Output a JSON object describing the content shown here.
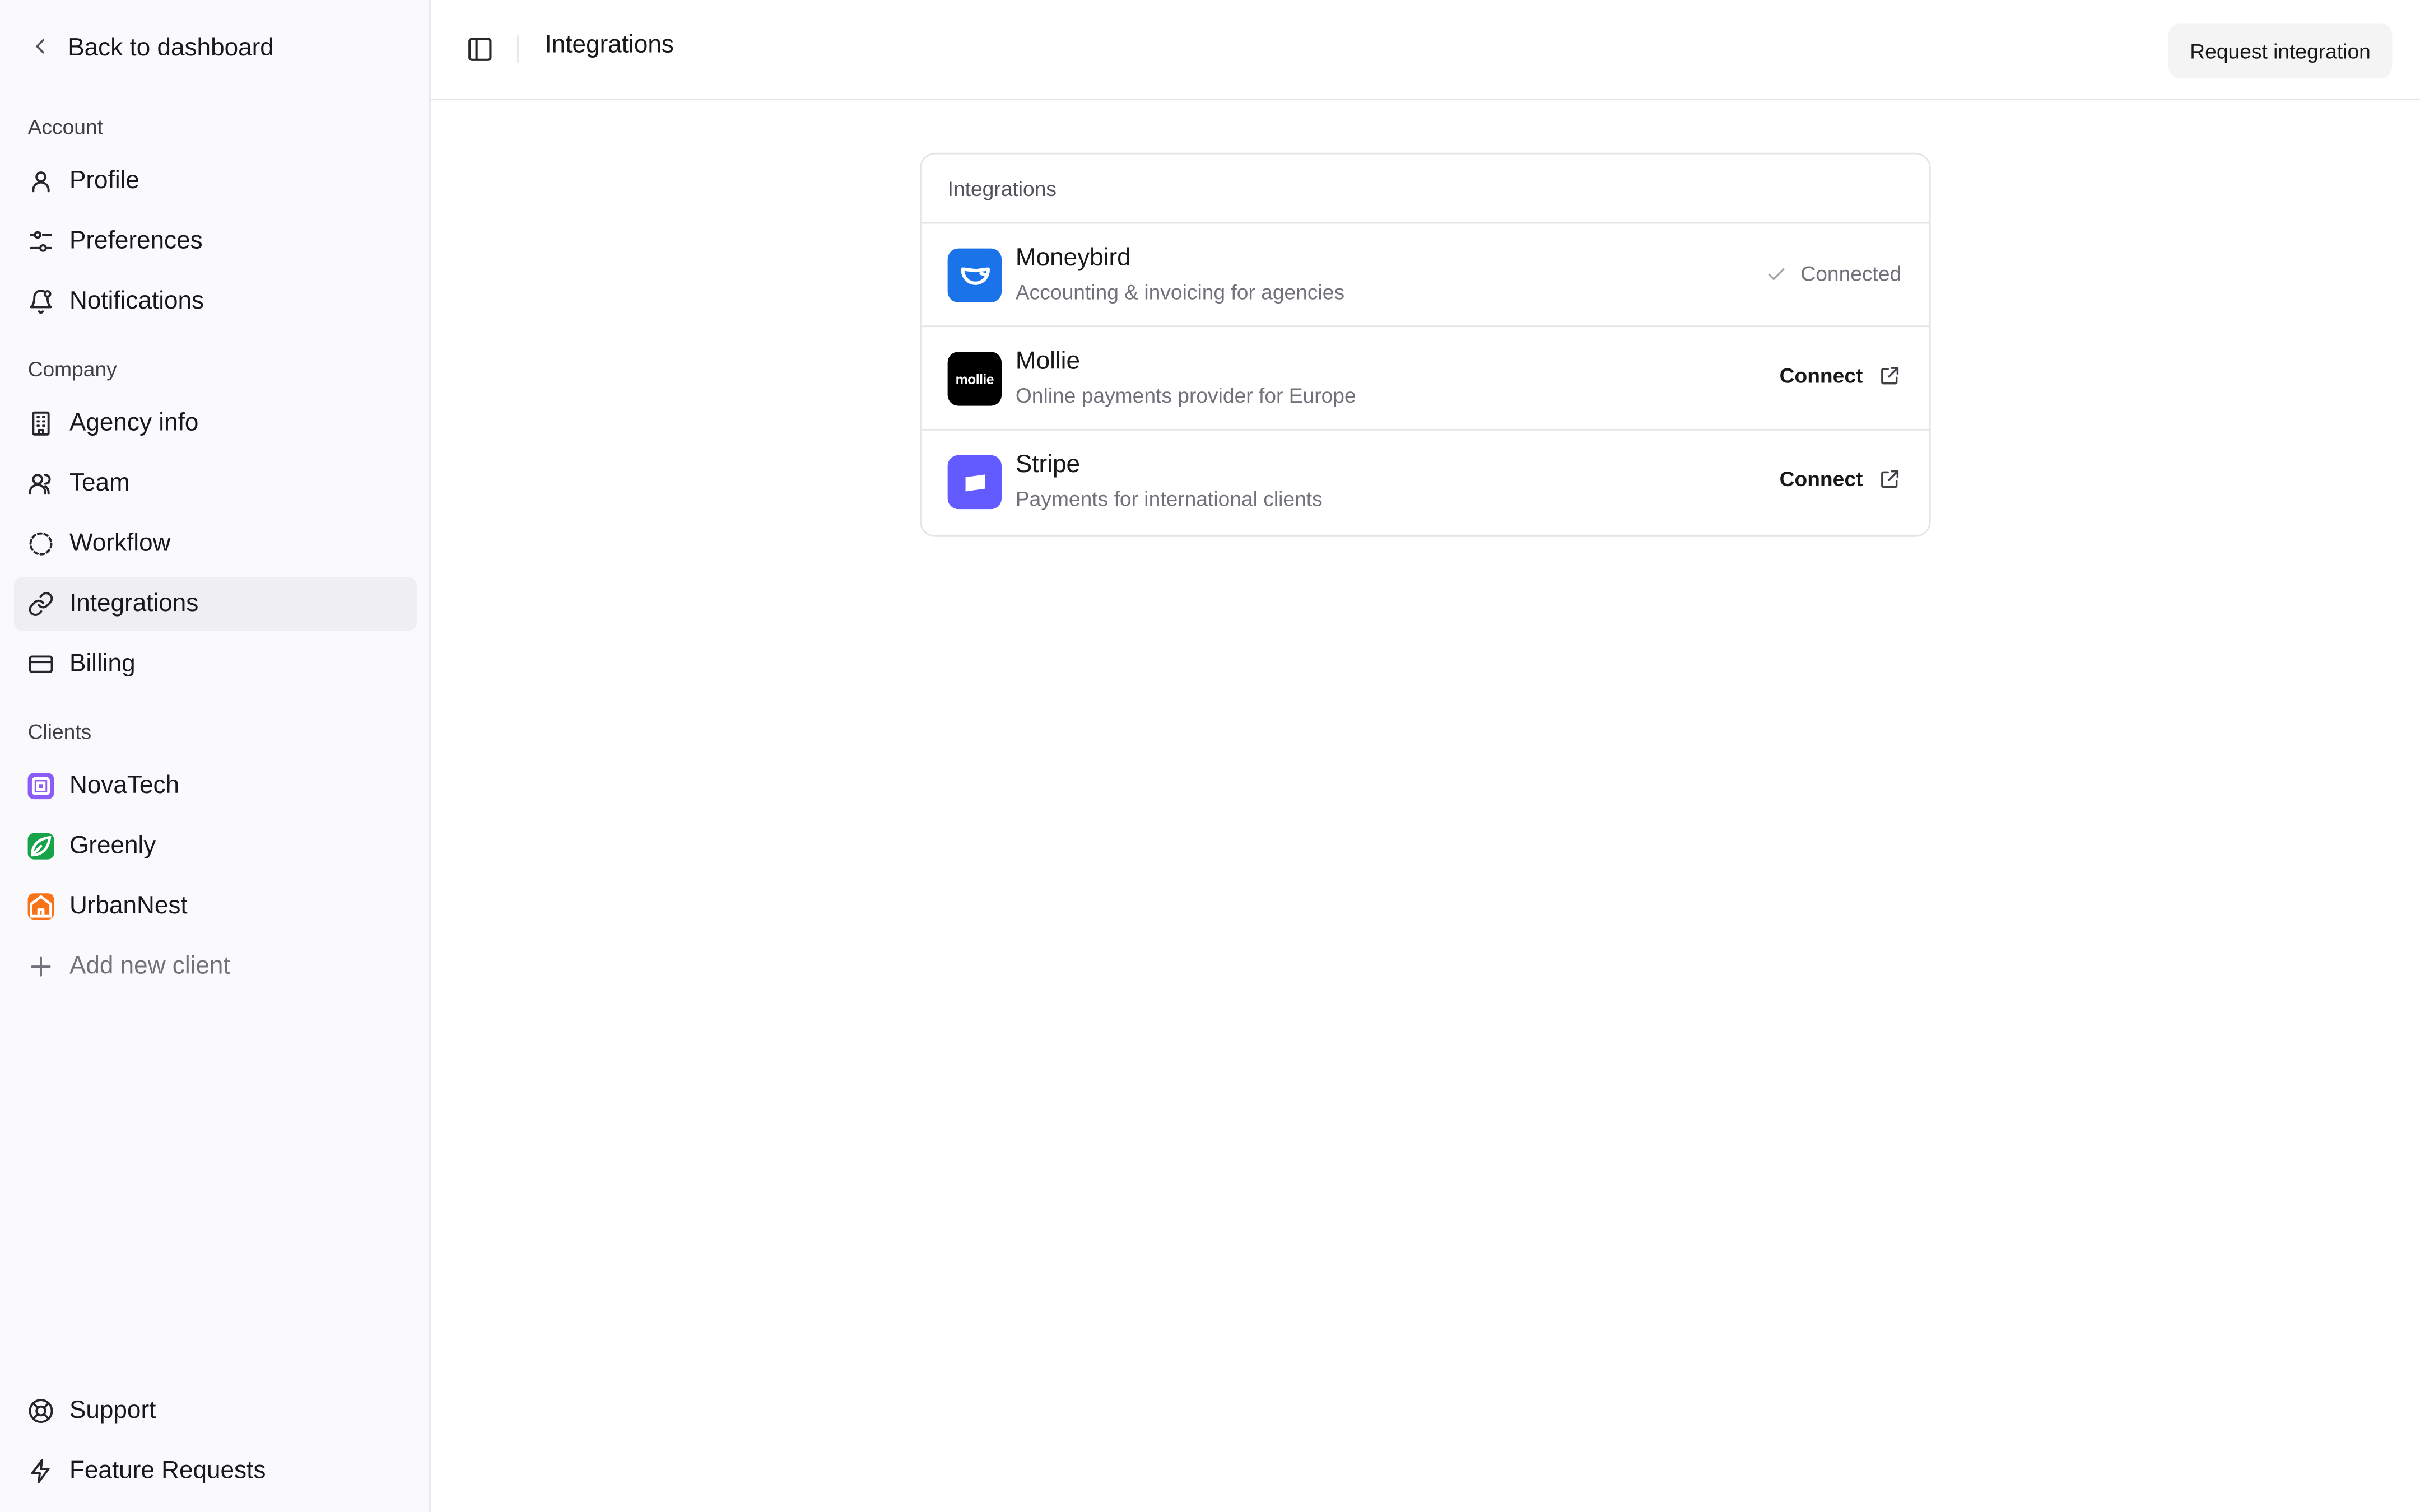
{
  "sidebar": {
    "back_label": "Back to dashboard",
    "sections": {
      "account": "Account",
      "company": "Company",
      "clients": "Clients"
    },
    "account_items": [
      {
        "label": "Profile",
        "icon": "user-icon"
      },
      {
        "label": "Preferences",
        "icon": "sliders-icon"
      },
      {
        "label": "Notifications",
        "icon": "bell-icon"
      }
    ],
    "company_items": [
      {
        "label": "Agency info",
        "icon": "building-icon"
      },
      {
        "label": "Team",
        "icon": "users-icon"
      },
      {
        "label": "Workflow",
        "icon": "dashed-circle-icon"
      },
      {
        "label": "Integrations",
        "icon": "link-icon",
        "active": true
      },
      {
        "label": "Billing",
        "icon": "credit-card-icon"
      }
    ],
    "clients": [
      {
        "label": "NovaTech",
        "color": "#8b5cf6"
      },
      {
        "label": "Greenly",
        "color": "#16a34a"
      },
      {
        "label": "UrbanNest",
        "color": "#f97316"
      }
    ],
    "add_client_label": "Add new client",
    "footer_items": [
      {
        "label": "Support",
        "icon": "lifebuoy-icon"
      },
      {
        "label": "Feature Requests",
        "icon": "zap-icon"
      }
    ]
  },
  "header": {
    "title": "Integrations",
    "request_button": "Request integration"
  },
  "card": {
    "title": "Integrations",
    "integrations": [
      {
        "name": "Moneybird",
        "description": "Accounting & invoicing for agencies",
        "status": "Connected",
        "logo_color": "#1a73e8"
      },
      {
        "name": "Mollie",
        "description": "Online payments provider for Europe",
        "action": "Connect",
        "logo_text": "mollie",
        "logo_color": "#000000"
      },
      {
        "name": "Stripe",
        "description": "Payments for international clients",
        "action": "Connect",
        "logo_color": "#635bff"
      }
    ]
  }
}
